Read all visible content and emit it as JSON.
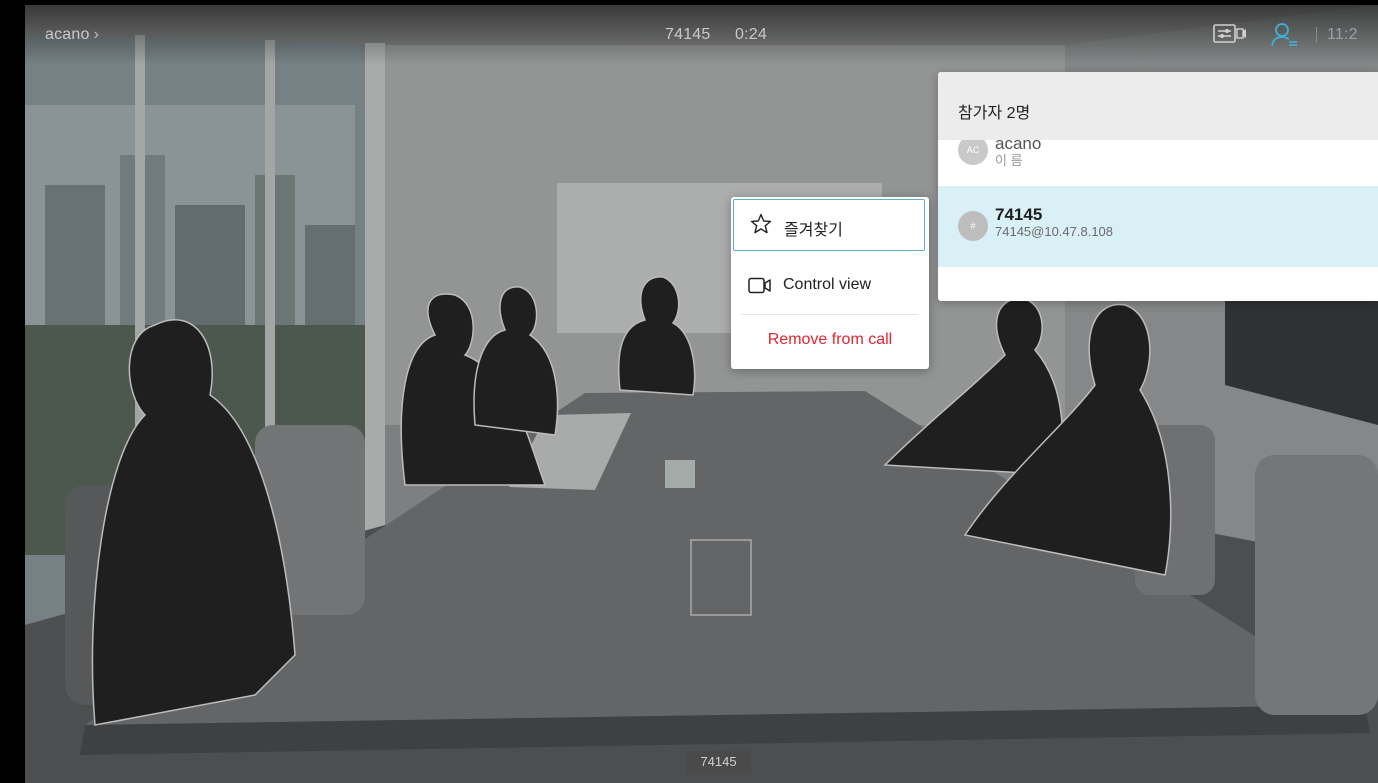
{
  "topbar": {
    "breadcrumb": "acano",
    "breadcrumb_chevron": "›",
    "call_number": "74145",
    "call_timer": "0:24",
    "clock": "11:2",
    "icons": [
      "layout-icon",
      "participants-icon"
    ]
  },
  "participants_panel": {
    "title": "참가자 2명",
    "participants": [
      {
        "avatar": "AC",
        "name": "acano",
        "subtitle": "이 름"
      },
      {
        "avatar": "#",
        "name": "74145",
        "subtitle": "74145@10.47.8.108"
      }
    ]
  },
  "context_menu": {
    "items": [
      {
        "label": "즐겨찾기",
        "icon": "star-icon"
      },
      {
        "label": "Control view",
        "icon": "camera-icon"
      },
      {
        "label": "Remove from call",
        "icon": null
      }
    ]
  },
  "self_view_label": "74145",
  "colors": {
    "accent_blue": "#5fb0cf",
    "selected_row": "#d9f0f6",
    "danger": "#e0262e"
  }
}
